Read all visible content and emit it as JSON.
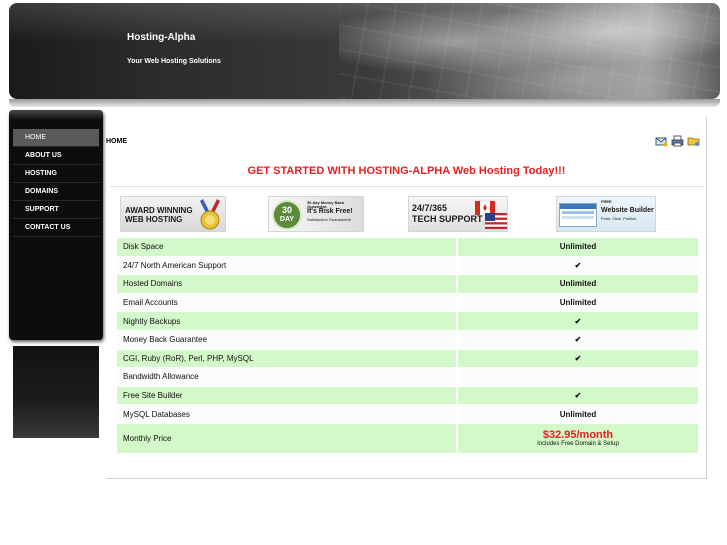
{
  "header": {
    "title": "Hosting-Alpha",
    "tagline": "Your Web Hosting Solutions"
  },
  "nav": {
    "items": [
      {
        "label": "HOME",
        "active": true
      },
      {
        "label": "ABOUT US",
        "active": false
      },
      {
        "label": "HOSTING",
        "active": false
      },
      {
        "label": "DOMAINS",
        "active": false
      },
      {
        "label": "SUPPORT",
        "active": false
      },
      {
        "label": "CONTACT US",
        "active": false
      }
    ]
  },
  "content": {
    "page_label": "HOME",
    "headline": "GET STARTED WITH HOSTING-ALPHA Web Hosting Today!!!",
    "icons": [
      "email-icon",
      "print-icon",
      "folder-icon"
    ]
  },
  "banners": {
    "award": {
      "line1": "AWARD WINNING",
      "line2": "WEB HOSTING"
    },
    "guarantee": {
      "badge_top": "30",
      "badge_bottom": "DAY",
      "line1": "30-day Money Back Guarantee",
      "line2": "It's Risk Free!",
      "line3": "Satisfaction Guaranteed!"
    },
    "support": {
      "line1": "24/7/365",
      "line2": "TECH SUPPORT"
    },
    "builder": {
      "line1": "FREE",
      "line2": "Website Builder",
      "line3": "Point. Click. Publish."
    }
  },
  "features": {
    "rows": [
      {
        "label": "Disk Space",
        "value": "Unlimited",
        "check": false
      },
      {
        "label": "24/7 North American Support",
        "value": "✔",
        "check": true
      },
      {
        "label": "Hosted Domains",
        "value": "Unlimited",
        "check": false
      },
      {
        "label": "Email Accounts",
        "value": "Unlimited",
        "check": false
      },
      {
        "label": "Nightly Backups",
        "value": "✔",
        "check": true
      },
      {
        "label": "Money Back Guarantee",
        "value": "✔",
        "check": true
      },
      {
        "label": "CGI, Ruby (RoR), Perl, PHP, MySQL",
        "value": "✔",
        "check": true
      },
      {
        "label": "Bandwidth Allowance",
        "value": "",
        "check": false
      },
      {
        "label": "Free Site Builder",
        "value": "✔",
        "check": true
      },
      {
        "label": "MySQL Databases",
        "value": "Unlimited",
        "check": false
      }
    ],
    "price": {
      "label": "Monthly Price",
      "amount": "$32.95/month",
      "note": "Includes Free Domain & Setup"
    }
  },
  "colors": {
    "accent_red": "#e8201f",
    "row_green": "#d3f8c9",
    "check_green": "#2f8f2f",
    "sidebar_bg": "#0d0d0d"
  }
}
